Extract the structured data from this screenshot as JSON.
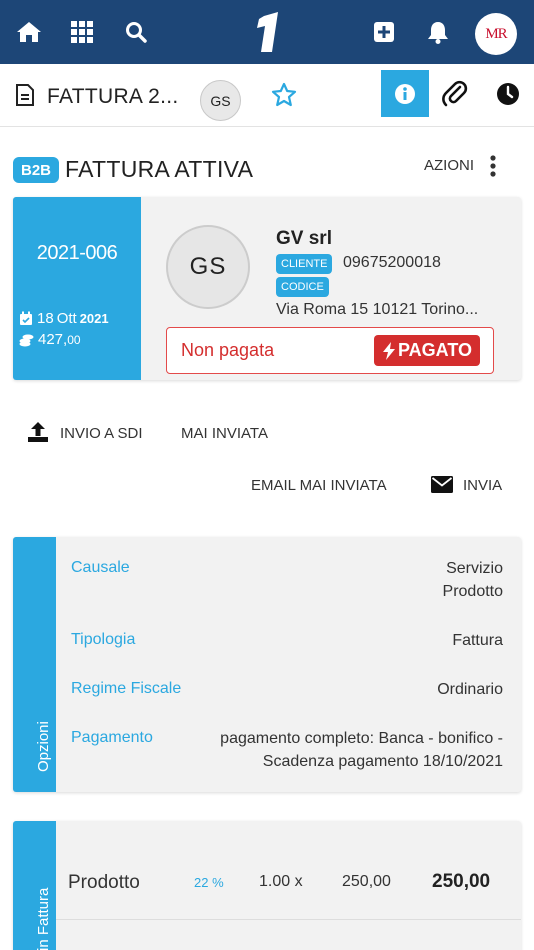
{
  "topbar": {
    "avatar_initials": "MR",
    "logo_text": "1"
  },
  "document": {
    "title": "FATTURA 2...",
    "client_initials": "GS"
  },
  "header": {
    "badge": "B2B",
    "title": "FATTURA ATTIVA",
    "actions_label": "AZIONI"
  },
  "invoice": {
    "number": "2021-006",
    "date_day": "18",
    "date_month": "Ott",
    "date_year": "2021",
    "amount_int": "427,",
    "amount_dec": "00",
    "client_initials": "GS",
    "client_name": "GV srl",
    "tag_cliente": "CLIENTE",
    "tag_codice": "CODICE",
    "client_code": "09675200018",
    "address": "Via Roma 15 10121 Torino...",
    "status": "Non pagata",
    "pay_button": "PAGATO"
  },
  "sdi": {
    "label": "INVIO A SDI",
    "status": "MAI INVIATA",
    "email_status": "EMAIL MAI INVIATA",
    "send_label": "INVIA"
  },
  "options": {
    "side_label": "Opzioni",
    "rows": [
      {
        "label": "Causale",
        "value_line1": "Servizio",
        "value_line2": "Prodotto"
      },
      {
        "label": "Tipologia",
        "value_line1": "Fattura"
      },
      {
        "label": "Regime Fiscale",
        "value_line1": "Ordinario"
      },
      {
        "label": "Pagamento",
        "value_line1": "pagamento completo: Banca - bonifico -",
        "value_line2": "Scadenza pagamento 18/10/2021"
      }
    ]
  },
  "lines": {
    "side_label": "in Fattura",
    "items": [
      {
        "name": "Prodotto",
        "vat": "22 %",
        "qty": "1.00 x",
        "price": "250,00",
        "total": "250,00"
      }
    ]
  },
  "colors": {
    "navbar": "#1d4677",
    "accent": "#2ba8e0",
    "danger": "#d42e2e",
    "card_bg": "#f2f2f2"
  }
}
